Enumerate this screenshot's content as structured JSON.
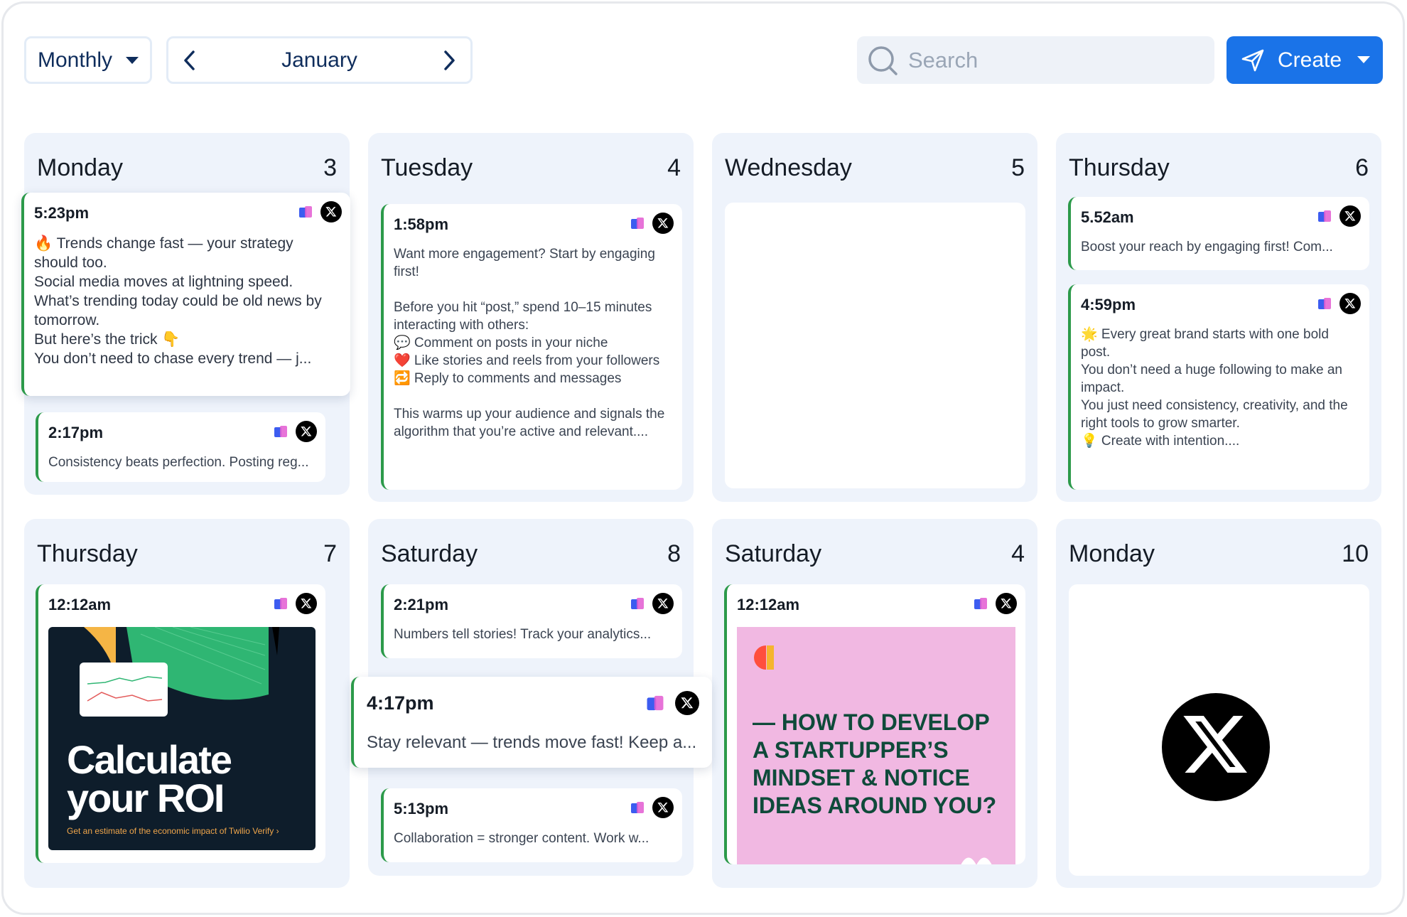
{
  "toolbar": {
    "view_label": "Monthly",
    "month_label": "January",
    "search_placeholder": "Search",
    "create_label": "Create"
  },
  "colors": {
    "accent": "#1a73e8",
    "post_border": "#2c9a4a",
    "column_bg": "#eef3fb"
  },
  "days": [
    {
      "name": "Monday",
      "number": "3",
      "posts": [
        {
          "time": "5:23pm",
          "text": "🔥 Trends change fast — your strategy should too.\nSocial media moves at lightning speed. What’s trending today could be old news by tomorrow.\n But here’s the trick 👇\n You don’t need to chase every trend — j..."
        },
        {
          "time": "2:17pm",
          "text": "Consistency beats perfection. Posting reg..."
        }
      ]
    },
    {
      "name": "Tuesday",
      "number": "4",
      "posts": [
        {
          "time": "1:58pm",
          "text": "Want more engagement? Start by engaging first!\n\nBefore you hit “post,” spend 10–15 minutes interacting with others:\n💬 Comment on posts in your niche\n❤️ Like stories and reels from your followers\n🔁 Reply to comments and messages\n\nThis warms up your audience and signals the algorithm that you’re active and relevant...."
        }
      ]
    },
    {
      "name": "Wednesday",
      "number": "5",
      "posts": []
    },
    {
      "name": "Thursday",
      "number": "6",
      "posts": [
        {
          "time": "5.52am",
          "text": "Boost your reach by engaging first! Com..."
        },
        {
          "time": "4:59pm",
          "text": "🌟 Every great brand starts with one bold post.\nYou don’t need a huge following to make an impact.\n You just need consistency, creativity, and the right tools to grow smarter.\n💡 Create with intention...."
        }
      ]
    },
    {
      "name": "Thursday",
      "number": "7",
      "posts": [
        {
          "time": "12:12am",
          "image_title": "Calculate your ROI",
          "image_subtitle": "Get an estimate of the economic impact of Twilio Verify ›"
        }
      ]
    },
    {
      "name": "Saturday",
      "number": "8",
      "posts": [
        {
          "time": "2:21pm",
          "text": "Numbers tell stories! Track your analytics..."
        },
        {
          "time": "4:17pm",
          "text": "Stay relevant — trends move fast! Keep a..."
        },
        {
          "time": "5:13pm",
          "text": "Collaboration = stronger content. Work w..."
        }
      ]
    },
    {
      "name": "Saturday",
      "number": "4",
      "posts": [
        {
          "time": "12:12am",
          "image_title": "— HOW TO DEVELOP A STARTUPPER’S MINDSET & NOTICE IDEAS AROUND YOU?"
        }
      ]
    },
    {
      "name": "Monday",
      "number": "10",
      "posts": []
    }
  ],
  "icons": {
    "app": "app-logo-icon",
    "x": "x-logo-icon",
    "search": "search-icon",
    "send": "send-icon"
  }
}
